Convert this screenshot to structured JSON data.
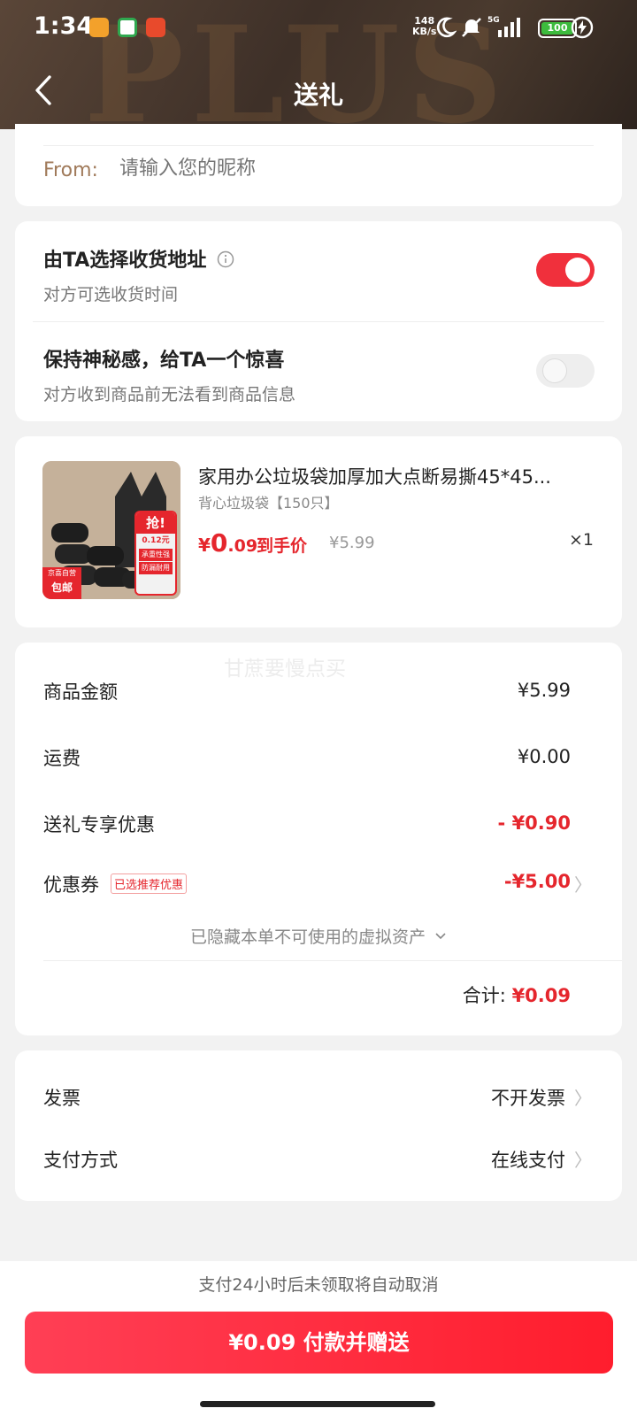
{
  "status": {
    "time": "1:34",
    "speed_value": "148",
    "speed_unit": "KB/s",
    "network": "5G",
    "battery": "100"
  },
  "header": {
    "title": "送礼",
    "watermark": "PLUS"
  },
  "sender": {
    "label": "From:",
    "placeholder": "请输入您的昵称"
  },
  "options": {
    "address": {
      "title": "由TA选择收货地址",
      "subtitle": "对方可选收货时间",
      "enabled": true
    },
    "mystery": {
      "title": "保持神秘感，给TA一个惊喜",
      "subtitle": "对方收到商品前无法看到商品信息",
      "enabled": false
    }
  },
  "product": {
    "name": "家用办公垃圾袋加厚加大点断易撕45*45...",
    "spec": "背心垃圾袋【150只】",
    "price_currency": "¥",
    "price_int": "0",
    "price_dec": ".09",
    "price_tag": "到手价",
    "original_price": "¥5.99",
    "quantity": "×1",
    "thumb_badge": "抢!",
    "thumb_price": "0.12元",
    "thumb_lines": [
      "承重性强",
      "防漏耐用"
    ],
    "thumb_footer": [
      "京喜自营",
      "包邮"
    ]
  },
  "summary": {
    "watermark": "甘蔗要慢点买",
    "rows": [
      {
        "label": "商品金额",
        "value": "¥5.99"
      },
      {
        "label": "运费",
        "value": "¥0.00"
      },
      {
        "label": "送礼专享优惠",
        "value": "- ¥0.90"
      },
      {
        "label": "优惠券",
        "value": "-¥5.00"
      }
    ],
    "coupon_badge": "已选推荐优惠",
    "hidden_note": "已隐藏本单不可使用的虚拟资产",
    "total_label": "合计:",
    "total_value": "¥0.09"
  },
  "settings": [
    {
      "label": "发票",
      "value": "不开发票"
    },
    {
      "label": "支付方式",
      "value": "在线支付"
    }
  ],
  "footer": {
    "notice": "支付24小时后未领取将自动取消",
    "pay_button": "¥0.09 付款并赠送"
  },
  "colors": {
    "accent": "#e5262d",
    "toggle_on": "#f0303c",
    "header_bg": "#3e3028"
  }
}
